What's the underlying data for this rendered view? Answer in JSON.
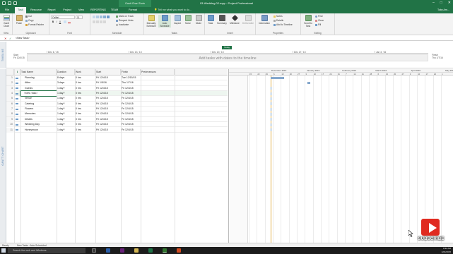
{
  "window": {
    "title": "03-Wedding 02.mpp - Project Professional",
    "context_tab": "Gantt Chart Tools",
    "min_glyph": "–",
    "max_glyph": "□",
    "close_glyph": "✕"
  },
  "tabs": [
    {
      "label": "File"
    },
    {
      "label": "Task"
    },
    {
      "label": "Resource"
    },
    {
      "label": "Report"
    },
    {
      "label": "Project"
    },
    {
      "label": "View"
    },
    {
      "label": "REPORTING"
    },
    {
      "label": "TEAM"
    },
    {
      "label": "Format"
    }
  ],
  "tell_me": "Tell me what you want to do...",
  "user": "Toby Arn...",
  "ribbon": {
    "view": {
      "gantt_label": "Gantt Chart",
      "group": "View"
    },
    "clipboard": {
      "paste": "Paste",
      "cut": "Cut",
      "copy": "Copy",
      "format_painter": "Format Painter",
      "group": "Clipboard"
    },
    "font": {
      "font_name": "Calibri",
      "font_size": "11",
      "bold": "B",
      "italic": "I",
      "underline": "U",
      "group": "Font"
    },
    "schedule": {
      "mark_on_track": "Mark on Track",
      "respect_links": "Respect Links",
      "inactivate": "Inactivate",
      "group": "Schedule"
    },
    "tasks": {
      "manually": "Manually Schedule",
      "auto": "Auto Schedule",
      "inspect": "Inspect",
      "move": "Move",
      "mode": "Mode",
      "group": "Tasks"
    },
    "insert": {
      "task": "Task",
      "summary": "Summary",
      "milestone": "Milestone",
      "deliverable": "Deliverable",
      "group": "Insert"
    },
    "properties": {
      "information": "Information",
      "notes": "Notes",
      "details": "Details",
      "add_to_timeline": "Add to Timeline",
      "group": "Properties"
    },
    "editing": {
      "scroll_to_task": "Scroll to Task",
      "find": "Find",
      "clear": "Clear",
      "fill": "Fill",
      "group": "Editing"
    }
  },
  "formula": {
    "cancel": "✕",
    "confirm": "✓",
    "value": "<New Task>"
  },
  "timeline": {
    "side_label": "TIMELINE",
    "today_label": "Today",
    "start_label": "Start",
    "start_date": "Fri 12/4/15",
    "finish_label": "Finish",
    "finish_date": "Thu 1/7/16",
    "ticks": [
      "Dec 6, '15",
      "Dec 13, '15",
      "Dec 20, '15",
      "Dec 27, '15",
      "Jan 3, '16"
    ],
    "placeholder": "Add tasks with dates to the timeline"
  },
  "grid": {
    "side_label": "GANTT CHART",
    "info_glyph": "ℹ",
    "headers": {
      "mode": "",
      "name": "Task Name",
      "duration": "Duration",
      "work": "Work",
      "start": "Start",
      "finish": "Finish",
      "pred": "Predecessors"
    },
    "rows": [
      {
        "num": "1",
        "name": "Planning",
        "duration": "8 days",
        "work": "0 hrs",
        "start": "Fri 12/4/15",
        "finish": "Tue 12/15/15"
      },
      {
        "num": "2",
        "name": "Attire",
        "duration": "3 days",
        "work": "0 hrs",
        "start": "Fri 1/5/16",
        "finish": "Thu 1/7/16"
      },
      {
        "num": "3",
        "name": "Guests",
        "duration": "1 day?",
        "work": "0 hrs",
        "start": "Fri 12/4/15",
        "finish": "Fri 12/4/15"
      },
      {
        "num": "4",
        "name": "<New Task>",
        "duration": "1 day?",
        "work": "0 hrs",
        "start": "Fri 12/4/15",
        "finish": "Fri 12/4/15"
      },
      {
        "num": "5",
        "name": "Venue",
        "duration": "1 day?",
        "work": "0 hrs",
        "start": "Fri 12/4/15",
        "finish": "Fri 12/4/15"
      },
      {
        "num": "6",
        "name": "Catering",
        "duration": "1 day?",
        "work": "0 hrs",
        "start": "Fri 12/4/15",
        "finish": "Fri 12/4/15"
      },
      {
        "num": "7",
        "name": "Flowers",
        "duration": "1 day?",
        "work": "0 hrs",
        "start": "Fri 12/4/15",
        "finish": "Fri 12/4/15"
      },
      {
        "num": "8",
        "name": "Memories",
        "duration": "1 day?",
        "work": "0 hrs",
        "start": "Fri 12/4/15",
        "finish": "Fri 12/4/15"
      },
      {
        "num": "9",
        "name": "Details",
        "duration": "1 day?",
        "work": "0 hrs",
        "start": "Fri 12/4/15",
        "finish": "Fri 12/4/15"
      },
      {
        "num": "10",
        "name": "Wedding Day",
        "duration": "1 day?",
        "work": "0 hrs",
        "start": "Fri 12/4/15",
        "finish": "Fri 12/4/15"
      },
      {
        "num": "11",
        "name": "Honeymoon",
        "duration": "1 day?",
        "work": "0 hrs",
        "start": "Fri 12/4/15",
        "finish": "Fri 12/4/15"
      }
    ]
  },
  "gantt": {
    "resource_col": "Resource Names",
    "months": [
      "December 2015",
      "January 2016",
      "February 2016",
      "March 2016",
      "April 2016",
      "May 201"
    ],
    "days": [
      "15",
      "22",
      "29",
      "6",
      "13",
      "20",
      "27",
      "3",
      "10",
      "17",
      "24",
      "31",
      "7",
      "14",
      "21",
      "28",
      "6",
      "13",
      "20",
      "27",
      "3",
      "10",
      "17",
      "24",
      "1"
    ]
  },
  "status": {
    "ready": "Ready",
    "new_tasks": "New Tasks : Auto Scheduled"
  },
  "taskbar": {
    "search": "Search the web and Windows",
    "time": "9:32 AM",
    "date": "12/4/2015"
  },
  "overlay": {
    "subscribe": "SUBSCRIBE"
  },
  "colors": {
    "brand": "#217346",
    "bar": "#9ab7d6",
    "today_line": "#e3b04b",
    "subscribe": "#e02a20"
  }
}
